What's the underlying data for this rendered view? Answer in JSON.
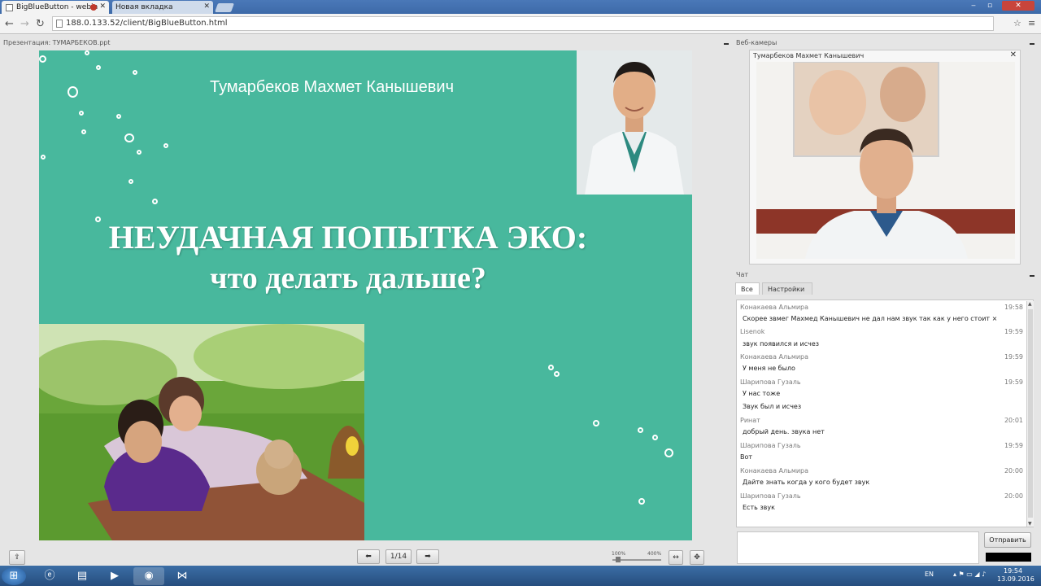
{
  "browser": {
    "tabs": [
      {
        "label": "BigBlueButton - webin"
      },
      {
        "label": "Новая вкладка"
      }
    ],
    "url": "188.0.133.52/client/BigBlueButton.html"
  },
  "presentation": {
    "title": "Презентация: ТУМАРБЕКОВ.ppt",
    "slide": {
      "presenter_name": "Тумарбеков Махмет Канышевич",
      "heading_line1": "НЕУДАЧНАЯ ПОПЫТКА ЭКО:",
      "heading_line2": "что делать дальше?"
    },
    "page_indicator": "1/14",
    "zoom_min": "100%",
    "zoom_max": "400%"
  },
  "webcams": {
    "title": "Веб-камеры",
    "window_title": "Тумарбеков Махмет Канышевич"
  },
  "chat": {
    "title": "Чат",
    "tabs": [
      {
        "label": "Все"
      },
      {
        "label": "Настройки"
      }
    ],
    "messages": [
      {
        "sender": "Конакаева Альмира",
        "time": "19:58",
        "lines": [
          "Скорее звмег Махмед Канышевич не дал нам звук так как у него стоит ×"
        ]
      },
      {
        "sender": "Lisenok",
        "time": "19:59",
        "lines": [
          "звук появился и исчез"
        ]
      },
      {
        "sender": "Конакаева Альмира",
        "time": "19:59",
        "lines": [
          "У меня не было"
        ]
      },
      {
        "sender": "Шарипова Гузаль",
        "time": "19:59",
        "lines": [
          "У нас тоже",
          "Звук был и исчез"
        ]
      },
      {
        "sender": "Ринат",
        "time": "20:01",
        "lines": [
          "добрый день. звука нет"
        ]
      },
      {
        "sender": "Шарипова Гузаль",
        "time": "19:59",
        "lines": [
          "Вот"
        ]
      },
      {
        "sender": "Конакаева Альмира",
        "time": "20:00",
        "lines": [
          "Дайте знать когда у кого будет звук"
        ]
      },
      {
        "sender": "Шарипова Гузаль",
        "time": "20:00",
        "lines": [
          "Есть звук"
        ]
      }
    ],
    "send_label": "Отправить"
  },
  "taskbar": {
    "lang": "EN",
    "time": "19:54",
    "date": "13.09.2016"
  }
}
